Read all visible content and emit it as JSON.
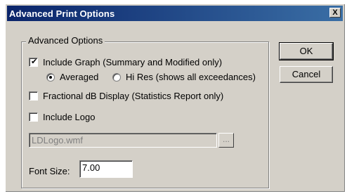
{
  "dialog": {
    "title": "Advanced Print Options",
    "close_label": "X"
  },
  "group": {
    "label": "Advanced Options"
  },
  "options": {
    "include_graph": {
      "label": "Include Graph (Summary and Modified only)",
      "checked": true
    },
    "averaged": {
      "label": "Averaged",
      "selected": true
    },
    "hi_res": {
      "label": "Hi Res (shows all exceedances)",
      "selected": false
    },
    "fractional_db": {
      "label": "Fractional dB Display (Statistics Report only)",
      "checked": false
    },
    "include_logo": {
      "label": "Include Logo",
      "checked": false
    }
  },
  "logo_file": {
    "value": "LDLogo.wmf",
    "browse_label": "..."
  },
  "font_size": {
    "label": "Font Size:",
    "value": "7.00"
  },
  "buttons": {
    "ok": "OK",
    "cancel": "Cancel"
  },
  "colors": {
    "title_start": "#0a246a",
    "title_end": "#3a6ea5",
    "face": "#d4d0c8"
  }
}
